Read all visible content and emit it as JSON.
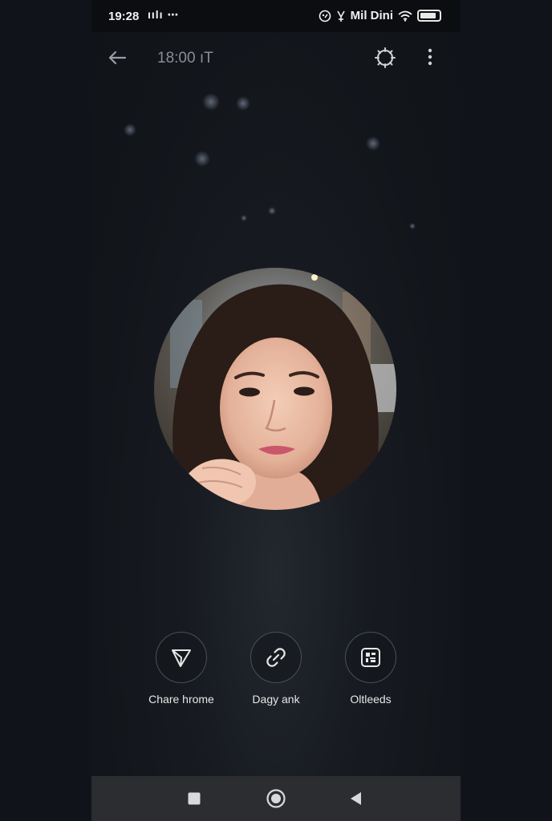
{
  "status_bar": {
    "time": "19:28",
    "left_icons": "ıılı ⋯",
    "network_label": "Mil Dini",
    "icons": [
      "media-icon",
      "signal-icon",
      "wifi-icon",
      "battery-icon"
    ]
  },
  "app_bar": {
    "title": "18:00 ıT",
    "icons": [
      "back-arrow-icon",
      "settings-gear-icon",
      "more-vertical-icon"
    ]
  },
  "profile": {
    "avatar_description_icon": "profile-photo"
  },
  "actions": [
    {
      "label": "Chare hrome",
      "icon": "send-share-icon"
    },
    {
      "label": "Dagy ank",
      "icon": "link-icon"
    },
    {
      "label": "Oltleeds",
      "icon": "qr-scan-icon"
    }
  ],
  "nav_bar": {
    "icons": [
      "recent-apps-icon",
      "home-icon",
      "back-icon"
    ]
  },
  "colors": {
    "background": "#10141a",
    "status_bar": "#0b0d10",
    "nav_bar": "#2b2d30",
    "text_primary": "#e6e6e6",
    "text_muted": "#8a8e94"
  }
}
